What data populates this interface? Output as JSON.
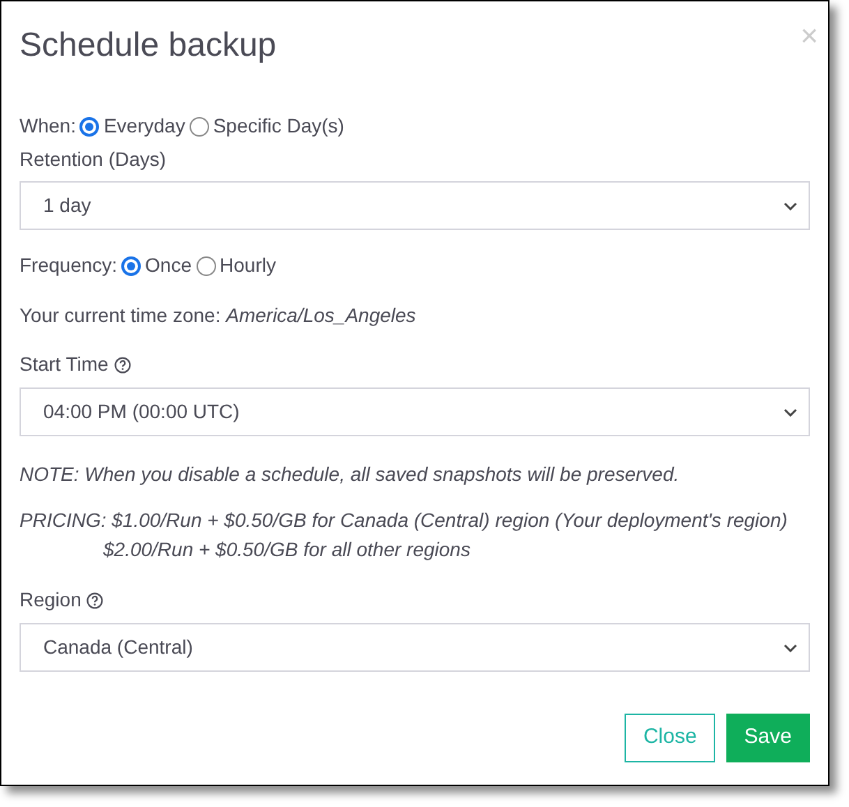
{
  "dialog": {
    "title": "Schedule backup",
    "close_glyph": "×"
  },
  "when": {
    "label": "When:",
    "options": [
      {
        "label": "Everyday",
        "selected": true
      },
      {
        "label": "Specific Day(s)",
        "selected": false
      }
    ]
  },
  "retention": {
    "label": "Retention (Days)",
    "value": "1 day"
  },
  "frequency": {
    "label": "Frequency:",
    "options": [
      {
        "label": "Once",
        "selected": true
      },
      {
        "label": "Hourly",
        "selected": false
      }
    ]
  },
  "timezone": {
    "text": "Your current time zone: *America/Los_Angeles*"
  },
  "start_time": {
    "label": "Start Time",
    "help": true,
    "value": "04:00 PM (00:00 UTC)"
  },
  "note": "NOTE: When you disable a schedule, all saved snapshots will be preserved.",
  "pricing": [
    "PRICING: $1.00/Run + $0.50/GB for Canada (Central) region (Your deployment's region)",
    "$2.00/Run + $0.50/GB for all other regions"
  ],
  "region": {
    "label": "Region",
    "help": true,
    "value": "Canada (Central)"
  },
  "buttons": [
    {
      "label": "Close",
      "kind": "secondary"
    },
    {
      "label": "Save",
      "kind": "primary"
    }
  ]
}
